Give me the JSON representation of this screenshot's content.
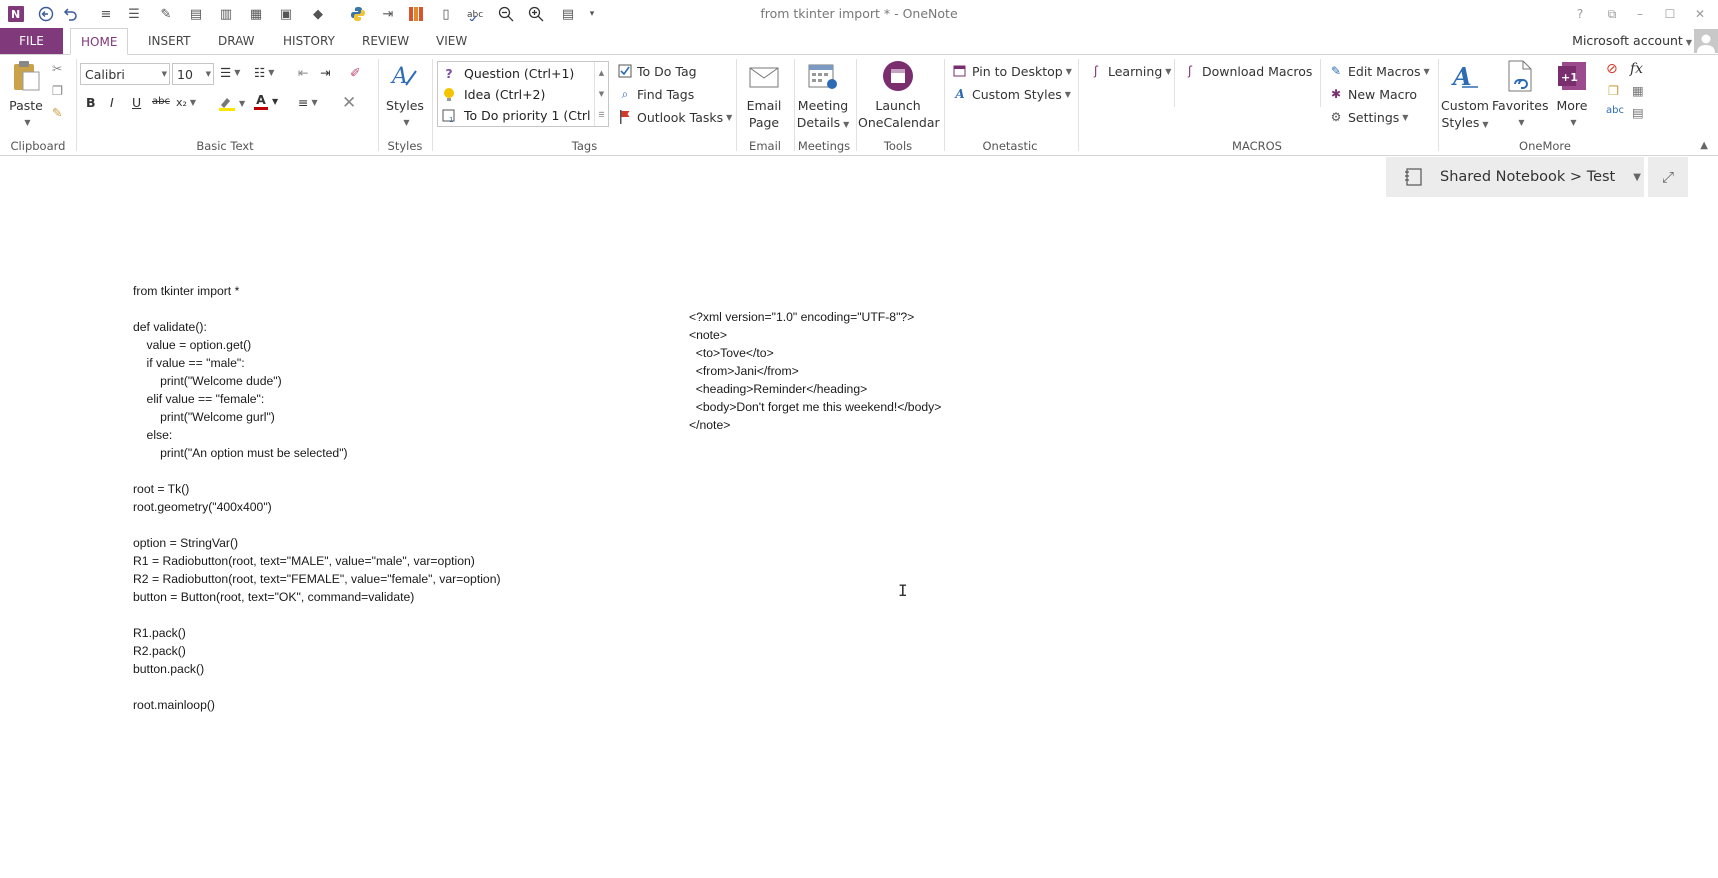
{
  "window": {
    "title": "from tkinter import * - OneNote",
    "controls": [
      "?",
      "⧉",
      "–",
      "☐",
      "✕"
    ]
  },
  "quick_access": [
    "onenote-app-icon",
    "back-icon",
    "undo-icon",
    "line-spacing-icon",
    "list-sort-icon",
    "eraser-icon",
    "notebook-icon",
    "notebook-open-icon",
    "template-icon",
    "page-template-icon",
    "shapes-icon",
    "python-icon",
    "indent-icon",
    "grid-icon",
    "page-icon",
    "spell-icon",
    "zoom-out-icon",
    "zoom-in-icon",
    "page-view-icon",
    "more-dropdown-icon"
  ],
  "tabs": {
    "file": "FILE",
    "items": [
      "HOME",
      "INSERT",
      "DRAW",
      "HISTORY",
      "REVIEW",
      "VIEW"
    ],
    "active": "HOME"
  },
  "account": "Microsoft account",
  "ribbon": {
    "clipboard": {
      "paste": "Paste",
      "label": "Clipboard"
    },
    "basic_text": {
      "font": "Calibri",
      "size": "10",
      "label": "Basic Text",
      "bold": "B",
      "italic": "I",
      "underline": "U",
      "strike": "abc",
      "subscript": "x₂",
      "font_color_letter": "A"
    },
    "styles": {
      "button": "Styles",
      "label": "Styles"
    },
    "tags": {
      "items": [
        "Question (Ctrl+1)",
        "Idea (Ctrl+2)",
        "To Do priority 1 (Ctrl"
      ],
      "todo": "To Do Tag",
      "find": "Find Tags",
      "outlook": "Outlook Tasks",
      "label": "Tags"
    },
    "email": {
      "line1": "Email",
      "line2": "Page",
      "label": "Email"
    },
    "meetings": {
      "line1": "Meeting",
      "line2": "Details",
      "label": "Meetings"
    },
    "tools": {
      "line1": "Launch",
      "line2": "OneCalendar",
      "label": "Tools"
    },
    "onetastic": {
      "pin": "Pin to Desktop",
      "custom": "Custom Styles",
      "label": "Onetastic"
    },
    "macros": {
      "learning": "Learning",
      "download": "Download Macros",
      "label": "MACROS"
    },
    "onemore": {
      "edit": "Edit Macros",
      "new": "New Macro",
      "settings": "Settings",
      "custom_line1": "Custom",
      "custom_line2": "Styles",
      "favorites": "Favorites",
      "more": "More",
      "fx": "fx",
      "label": "OneMore"
    }
  },
  "notebook_path": "Shared Notebook > Test",
  "page": {
    "code_lines": [
      "from tkinter import *",
      "",
      "def validate():",
      "    value = option.get()",
      "    if value == \"male\":",
      "        print(\"Welcome dude\")",
      "    elif value == \"female\":",
      "        print(\"Welcome gurl\")",
      "    else:",
      "        print(\"An option must be selected\")",
      "",
      "root = Tk()",
      "root.geometry(\"400x400\")",
      "",
      "option = StringVar()",
      "R1 = Radiobutton(root, text=\"MALE\", value=\"male\", var=option)",
      "R2 = Radiobutton(root, text=\"FEMALE\", value=\"female\", var=option)",
      "button = Button(root, text=\"OK\", command=validate)",
      "",
      "R1.pack()",
      "R2.pack()",
      "button.pack()",
      "",
      "root.mainloop()"
    ],
    "xml_lines": [
      "<?xml version=\"1.0\" encoding=\"UTF-8\"?>",
      "<note>",
      "  <to>Tove</to>",
      "  <from>Jani</from>",
      "  <heading>Reminder</heading>",
      "  <body>Don't forget me this weekend!</body>",
      "</note>"
    ]
  },
  "colors": {
    "accent": "#80397b",
    "ribbon_border": "#d4d4d4",
    "breadcrumb_bg": "#ececec"
  }
}
